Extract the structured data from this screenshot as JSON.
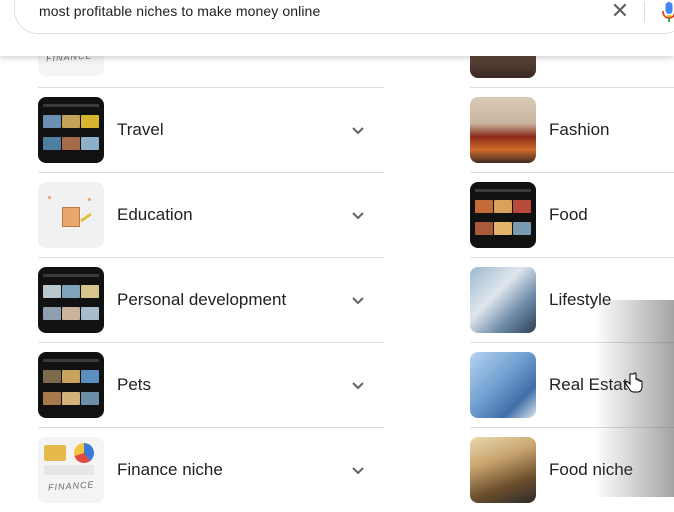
{
  "search": {
    "query": "most profitable niches to make money online",
    "clear_icon": "close-icon",
    "mic_icon": "microphone-icon"
  },
  "left_items": [
    {
      "label": "Travel",
      "thumb": "video-grid",
      "expand_icon": "chevron-down-icon"
    },
    {
      "label": "Education",
      "thumb": "education-illustration",
      "expand_icon": "chevron-down-icon"
    },
    {
      "label": "Personal development",
      "thumb": "video-grid",
      "expand_icon": "chevron-down-icon"
    },
    {
      "label": "Pets",
      "thumb": "video-grid",
      "expand_icon": "chevron-down-icon"
    },
    {
      "label": "Finance niche",
      "thumb": "finance-illustration",
      "expand_icon": "chevron-down-icon"
    }
  ],
  "right_items": [
    {
      "label": "Fashion",
      "thumb": "fashion-photo"
    },
    {
      "label": "Food",
      "thumb": "video-grid"
    },
    {
      "label": "Lifestyle",
      "thumb": "lifestyle-photo"
    },
    {
      "label": "Real Estate",
      "thumb": "real-estate-photo"
    },
    {
      "label": "Food niche",
      "thumb": "food-photo"
    }
  ],
  "partial_top": {
    "left_thumb_text": "FINANCE"
  },
  "finance_thumb_text": "FINANCE",
  "colors": {
    "text": "#202124",
    "divider": "#dadce0",
    "icon": "#5f6368"
  }
}
